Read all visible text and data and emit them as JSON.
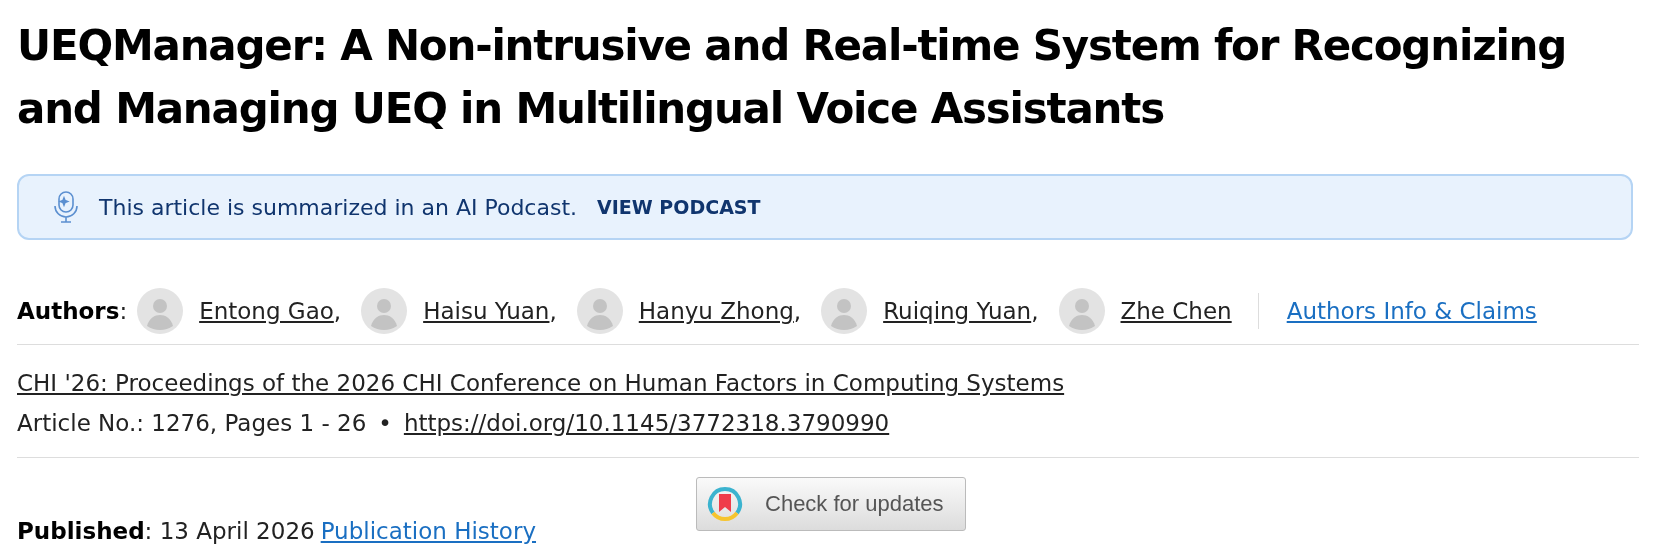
{
  "title": "UEQManager: A Non-intrusive and Real-time System for Recognizing and Managing UEQ in Multilingual Voice Assistants",
  "podcast_banner": {
    "text": "This article is summarized in an AI Podcast.",
    "link": "VIEW PODCAST"
  },
  "authors": {
    "label": "Authors",
    "separator": ":",
    "names": [
      {
        "name": "Entong Gao",
        "comma": ","
      },
      {
        "name": "Haisu Yuan",
        "comma": ","
      },
      {
        "name": "Hanyu Zhong",
        "comma": ","
      },
      {
        "name": "Ruiqing Yuan",
        "comma": ","
      },
      {
        "name": "Zhe Chen"
      }
    ],
    "info_link": "Authors Info & Claims"
  },
  "proceedings": "CHI '26: Proceedings of the 2026 CHI Conference on Human Factors in Computing Systems",
  "article_info": {
    "text": "Article No.: 1276, Pages 1 - 26",
    "bullet": "•",
    "doi": "https://doi.org/10.1145/3772318.3790990"
  },
  "published": {
    "label": "Published",
    "separator": ":",
    "date": "13 April 2026",
    "history_link": "Publication History"
  },
  "check_updates_button": "Check for updates"
}
